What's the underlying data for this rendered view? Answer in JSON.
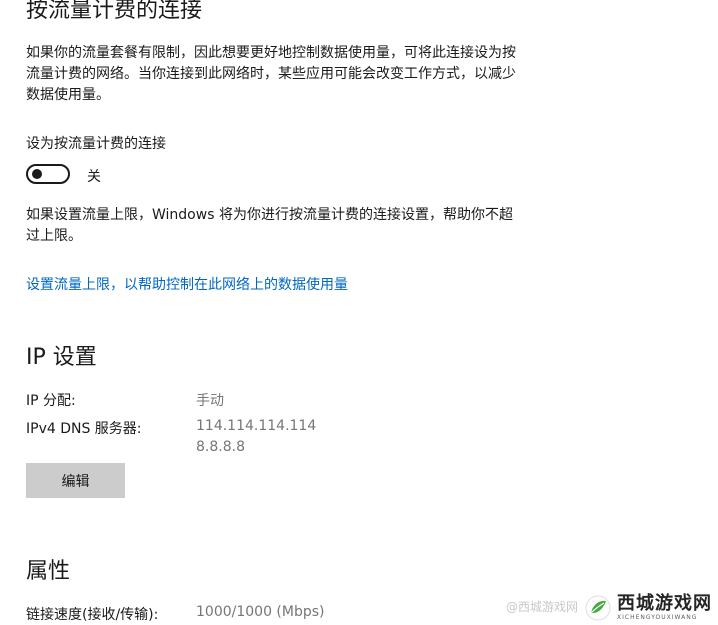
{
  "metered": {
    "title": "按流量计费的连接",
    "description": "如果你的流量套餐有限制，因此想要更好地控制数据使用量，可将此连接设为按流量计费的网络。当你连接到此网络时，某些应用可能会改变工作方式，以减少数据使用量。",
    "toggle_label": "设为按流量计费的连接",
    "toggle_state": "关",
    "toggle_on": false,
    "limit_note": "如果设置流量上限，Windows 将为你进行按流量计费的连接设置，帮助你不超过上限。",
    "limit_link": "设置流量上限，以帮助控制在此网络上的数据使用量"
  },
  "ip": {
    "title": "IP 设置",
    "rows": [
      {
        "label": "IP 分配:",
        "value": "手动"
      },
      {
        "label": "IPv4 DNS 服务器:",
        "value": "114.114.114.114",
        "value2": "8.8.8.8"
      }
    ],
    "edit_label": "编辑"
  },
  "properties": {
    "title": "属性",
    "rows": [
      {
        "label": "链接速度(接收/传输):",
        "value": "1000/1000 (Mbps)"
      }
    ]
  },
  "watermark": {
    "main": "西城游戏网",
    "sub": "XICHENGYOUXIWANG",
    "faint": "@西城游戏网"
  },
  "colors": {
    "link": "#0067c0",
    "secondary_text": "#767676",
    "button_bg": "#cccccc"
  }
}
